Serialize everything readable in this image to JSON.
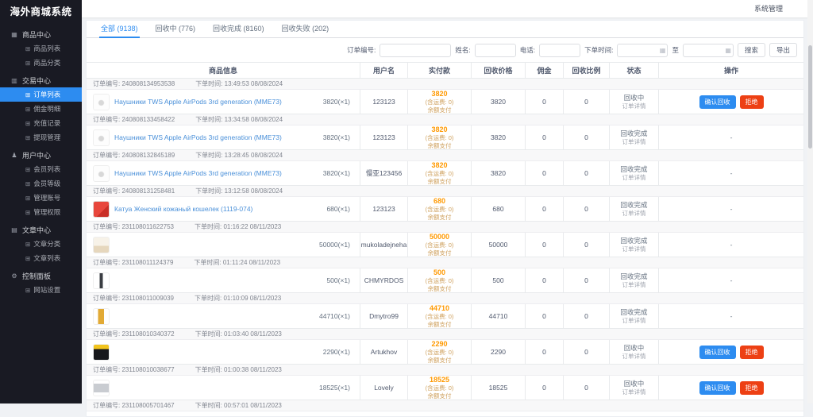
{
  "app": {
    "title": "海外商城系统",
    "topbar_right": "系统管理"
  },
  "sidebar": {
    "sections": [
      {
        "icon": "grid-icon",
        "glyph": "▦",
        "label": "商品中心",
        "items": [
          {
            "label": "商品列表"
          },
          {
            "label": "商品分类"
          }
        ]
      },
      {
        "icon": "chart-icon",
        "glyph": "▥",
        "label": "交易中心",
        "items": [
          {
            "label": "订单列表",
            "active": true
          },
          {
            "label": "佣金明细"
          },
          {
            "label": "充值记录"
          },
          {
            "label": "提现管理"
          }
        ]
      },
      {
        "icon": "user-icon",
        "glyph": "♟",
        "label": "用户中心",
        "items": [
          {
            "label": "会员列表"
          },
          {
            "label": "会员等级"
          },
          {
            "label": "管理账号"
          },
          {
            "label": "管理权限"
          }
        ]
      },
      {
        "icon": "doc-icon",
        "glyph": "▤",
        "label": "文章中心",
        "items": [
          {
            "label": "文章分类"
          },
          {
            "label": "文章列表"
          }
        ]
      },
      {
        "icon": "gear-icon",
        "glyph": "⚙",
        "label": "控制面板",
        "items": [
          {
            "label": "网站设置"
          }
        ]
      }
    ],
    "subitem_glyph": "⊞"
  },
  "tabs": [
    {
      "label": "全部 (9138)",
      "active": true
    },
    {
      "label": "回收中 (776)",
      "active": false
    },
    {
      "label": "回收完成 (8160)",
      "active": false
    },
    {
      "label": "回收失败 (202)",
      "active": false
    }
  ],
  "filters": {
    "order_no_label": "订单编号:",
    "name_label": "姓名:",
    "phone_label": "电话:",
    "time_label": "下单时间:",
    "to_label": "至",
    "search_label": "搜索",
    "export_label": "导出",
    "calendar_glyph": "▦"
  },
  "table": {
    "headers": [
      "商品信息",
      "用户名",
      "实付款",
      "回收价格",
      "佣金",
      "回收比例",
      "状态",
      "操作"
    ],
    "labels": {
      "order_no": "订单编号:",
      "order_time": "下单时间:",
      "freight": "(含运费: 0)",
      "pay_method": "余额支付",
      "detail": "订单详情",
      "confirm": "确认回收",
      "reject": "拒绝",
      "dash": "-"
    },
    "rows": [
      {
        "order": "240808134953538",
        "time": "13:49:53 08/08/2024",
        "product": "Наушники TWS Apple AirPods 3rd generation (MME73)",
        "qty": "3820(×1)",
        "user": "123123",
        "paid": "3820",
        "recycle": "3820",
        "commission": "0",
        "ratio": "0",
        "status": "回收中",
        "actions": true,
        "thumb": "airpods-case"
      },
      {
        "order": "240808133458422",
        "time": "13:34:58 08/08/2024",
        "product": "Наушники TWS Apple AirPods 3rd generation (MME73)",
        "qty": "3820(×1)",
        "user": "123123",
        "paid": "3820",
        "recycle": "3820",
        "commission": "0",
        "ratio": "0",
        "status": "回收完成",
        "actions": false,
        "thumb": "airpods-case"
      },
      {
        "order": "240808132845189",
        "time": "13:28:45 08/08/2024",
        "product": "Наушники TWS Apple AirPods 3rd generation (MME73)",
        "qty": "3820(×1)",
        "user": "慢亚123456",
        "paid": "3820",
        "recycle": "3820",
        "commission": "0",
        "ratio": "0",
        "status": "回收完成",
        "actions": false,
        "thumb": "airpods-case"
      },
      {
        "order": "240808131258481",
        "time": "13:12:58 08/08/2024",
        "product": "Катуа Женский кожаный кошелек (1119-074)",
        "qty": "680(×1)",
        "user": "123123",
        "paid": "680",
        "recycle": "680",
        "commission": "0",
        "ratio": "0",
        "status": "回收完成",
        "actions": false,
        "thumb": "red-wallet"
      },
      {
        "order": "231108011622753",
        "time": "01:16:22 08/11/2023",
        "product": "",
        "qty": "50000(×1)",
        "user": "mukoladejneha",
        "paid": "50000",
        "recycle": "50000",
        "commission": "0",
        "ratio": "0",
        "status": "回收完成",
        "actions": false,
        "thumb": "beige-item"
      },
      {
        "order": "231108011124379",
        "time": "01:11:24 08/11/2023",
        "product": "",
        "qty": "500(×1)",
        "user": "CHMYRDOS",
        "paid": "500",
        "recycle": "500",
        "commission": "0",
        "ratio": "0",
        "status": "回收完成",
        "actions": false,
        "thumb": "dark-pen"
      },
      {
        "order": "231108011009039",
        "time": "01:10:09 08/11/2023",
        "product": "",
        "qty": "44710(×1)",
        "user": "Dmytro99",
        "paid": "44710",
        "recycle": "44710",
        "commission": "0",
        "ratio": "0",
        "status": "回收完成",
        "actions": false,
        "thumb": "gold-bar"
      },
      {
        "order": "231108010340372",
        "time": "01:03:40 08/11/2023",
        "product": "",
        "qty": "2290(×1)",
        "user": "Artukhov",
        "paid": "2290",
        "recycle": "2290",
        "commission": "0",
        "ratio": "0",
        "status": "回收中",
        "actions": true,
        "thumb": "black-jar"
      },
      {
        "order": "231108010038677",
        "time": "01:00:38 08/11/2023",
        "product": "",
        "qty": "18525(×1)",
        "user": "Lovely",
        "paid": "18525",
        "recycle": "18525",
        "commission": "0",
        "ratio": "0",
        "status": "回收中",
        "actions": true,
        "thumb": "gray-controller"
      }
    ],
    "partial_row": {
      "order": "231108005701467",
      "time": "00:57:01 08/11/2023"
    }
  }
}
